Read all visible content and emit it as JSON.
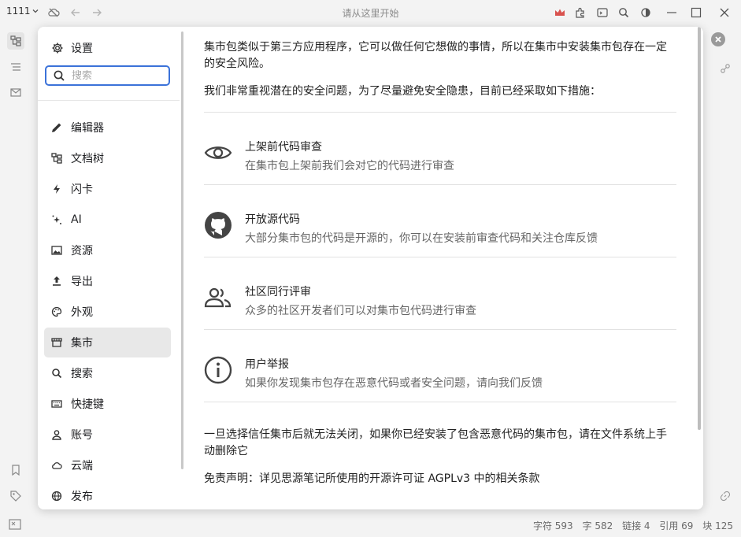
{
  "topbar": {
    "workspace": "1111",
    "search_hint": "请从这里开始"
  },
  "settings": {
    "title": "设置",
    "search_placeholder": "搜索",
    "nav": [
      {
        "label": "编辑器",
        "icon": "pencil-icon"
      },
      {
        "label": "文档树",
        "icon": "doctree-icon"
      },
      {
        "label": "闪卡",
        "icon": "lightning-icon"
      },
      {
        "label": "AI",
        "icon": "sparkle-icon"
      },
      {
        "label": "资源",
        "icon": "image-icon"
      },
      {
        "label": "导出",
        "icon": "upload-icon"
      },
      {
        "label": "外观",
        "icon": "palette-icon"
      },
      {
        "label": "集市",
        "icon": "store-icon"
      },
      {
        "label": "搜索",
        "icon": "search-icon"
      },
      {
        "label": "快捷键",
        "icon": "keyboard-icon"
      },
      {
        "label": "账号",
        "icon": "user-icon"
      },
      {
        "label": "云端",
        "icon": "cloud-icon"
      },
      {
        "label": "发布",
        "icon": "globe-icon"
      }
    ],
    "active_index": 7
  },
  "content": {
    "intro_line1": "集市包类似于第三方应用程序，它可以做任何它想做的事情，所以在集市中安装集市包存在一定",
    "intro_line2": "的安全风险。",
    "measures": "我们非常重视潜在的安全问题，为了尽量避免安全隐患，目前已经采取如下措施：",
    "features": [
      {
        "icon": "eye-icon",
        "title": "上架前代码审查",
        "desc": "在集市包上架前我们会对它的代码进行审查"
      },
      {
        "icon": "github-icon",
        "title": "开放源代码",
        "desc": "大部分集市包的代码是开源的，你可以在安装前审查代码和关注仓库反馈"
      },
      {
        "icon": "users-icon",
        "title": "社区同行评审",
        "desc": "众多的社区开发者们可以对集市包代码进行审查"
      },
      {
        "icon": "info-icon",
        "title": "用户举报",
        "desc": "如果你发现集市包存在恶意代码或者安全问题，请向我们反馈"
      }
    ],
    "warning_line1": "一旦选择信任集市后就无法关闭，如果你已经安装了包含恶意代码的集市包，请在文件系统上手",
    "warning_line2": "动删除它",
    "disclaimer": "免责声明：详见思源笔记所使用的开源许可证 AGPLv3 中的相关条款"
  },
  "status": {
    "chars": "字符 593",
    "words": "字 582",
    "links": "链接 4",
    "refs": "引用 69",
    "blocks": "块 125"
  },
  "colors": {
    "accent": "#3b72d9",
    "crown": "#d9534f",
    "nav_active": "#e8e8e8"
  }
}
